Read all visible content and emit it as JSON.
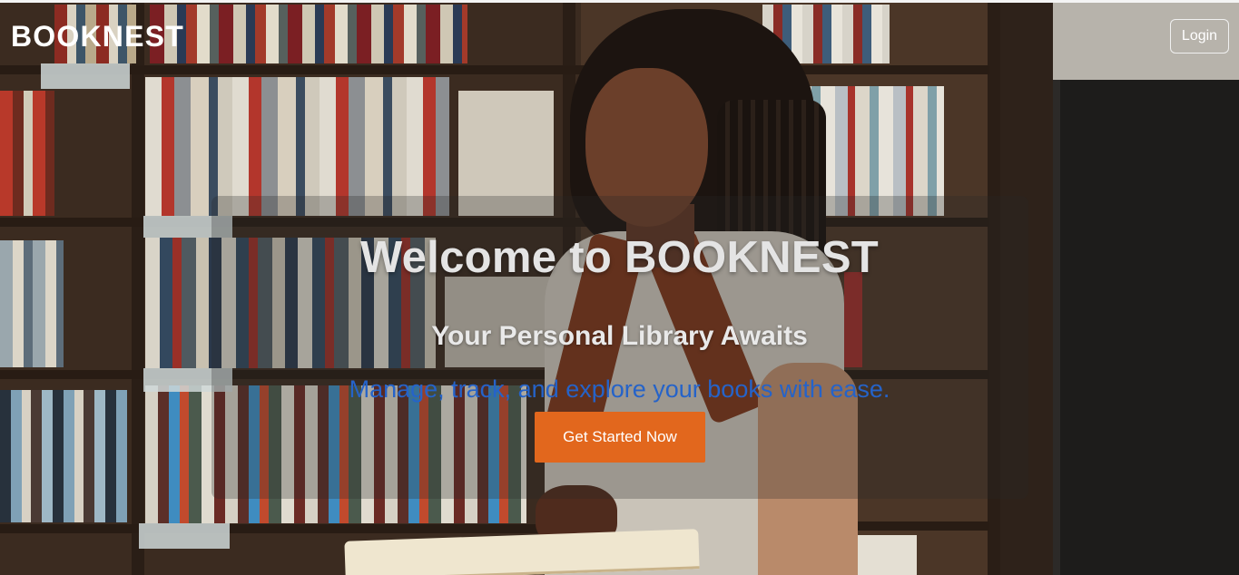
{
  "header": {
    "brand": "BOOKNEST",
    "login_label": "Login"
  },
  "hero": {
    "title": "Welcome to BOOKNEST",
    "subtitle": "Your Personal Library Awaits",
    "tagline": "Manage, track, and explore your books with ease.",
    "cta_label": "Get Started Now"
  },
  "colors": {
    "brand_text": "#ffffff",
    "cta_background": "#e2671d",
    "tagline_text": "#2563c9",
    "title_text": "#e4e4e4"
  }
}
